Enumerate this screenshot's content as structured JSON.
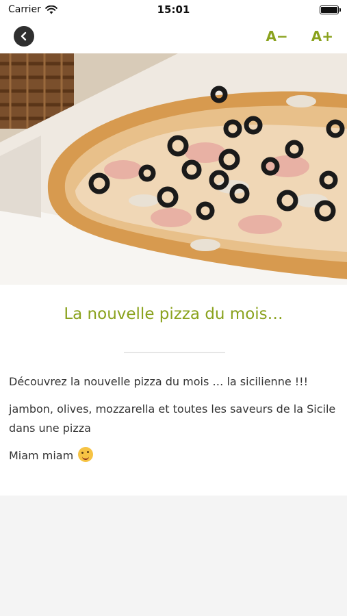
{
  "status_bar": {
    "carrier": "Carrier",
    "time": "15:01"
  },
  "nav": {
    "back_icon": "chevron-left",
    "font_decrease": "A−",
    "font_increase": "A+",
    "accent_color": "#8aa21d"
  },
  "hero_image": {
    "icon": "pizza-photo"
  },
  "article": {
    "title": "La nouvelle pizza du mois…",
    "paragraphs": [
      "Découvrez la nouvelle pizza du mois … la sicilienne !!!",
      "jambon, olives, mozzarella et toutes les saveurs de la Sicile dans une pizza",
      "Miam miam"
    ],
    "emoji": "yum-face-emoji"
  }
}
